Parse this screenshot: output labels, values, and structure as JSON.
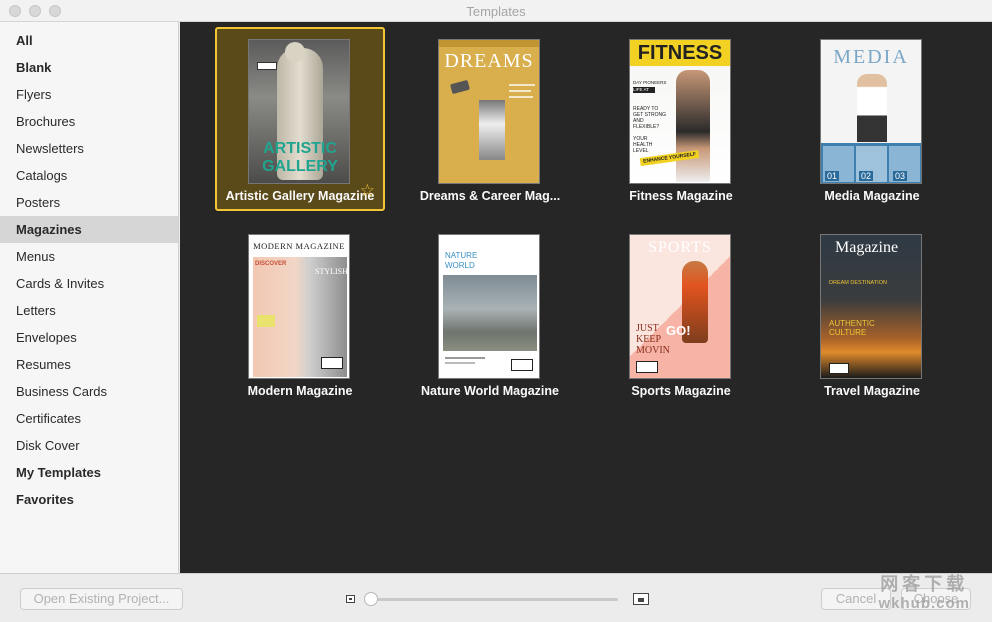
{
  "window": {
    "title": "Templates"
  },
  "sidebar": {
    "items": [
      {
        "label": "All",
        "bold": true
      },
      {
        "label": "Blank",
        "bold": true
      },
      {
        "label": "Flyers"
      },
      {
        "label": "Brochures"
      },
      {
        "label": "Newsletters"
      },
      {
        "label": "Catalogs"
      },
      {
        "label": "Posters"
      },
      {
        "label": "Magazines",
        "selected": true
      },
      {
        "label": "Menus"
      },
      {
        "label": "Cards & Invites"
      },
      {
        "label": "Letters"
      },
      {
        "label": "Envelopes"
      },
      {
        "label": "Resumes"
      },
      {
        "label": "Business Cards"
      },
      {
        "label": "Certificates"
      },
      {
        "label": "Disk Cover"
      },
      {
        "label": "My Templates",
        "bold": true
      },
      {
        "label": "Favorites",
        "bold": true
      }
    ]
  },
  "templates": [
    {
      "name": "Artistic Gallery Magazine",
      "selected": true,
      "favorite": true,
      "cover": {
        "title_line1": "ARTISTIC",
        "title_line2": "GALLERY"
      }
    },
    {
      "name": "Dreams & Career Mag...",
      "cover": {
        "title": "DREAMS"
      }
    },
    {
      "name": "Fitness Magazine",
      "cover": {
        "title": "FITNESS",
        "lines": [
          "DAY PIONEERS",
          "LIFE AT",
          "READY TO",
          "GET STRONG",
          "AND",
          "FLEXIBLE?",
          "YOUR",
          "HEALTH",
          "LEVEL"
        ],
        "badge": "ENHANCE YOURSELF"
      }
    },
    {
      "name": "Media Magazine",
      "cover": {
        "title": "MEDIA",
        "nums": [
          "01",
          "02",
          "03"
        ]
      }
    },
    {
      "name": "Modern Magazine",
      "cover": {
        "title": "MODERN MAGAZINE",
        "side": "STYLISH",
        "left": "DISCOVER"
      }
    },
    {
      "name": "Nature World Magazine",
      "cover": {
        "title_line1": "NATURE",
        "title_line2": "WORLD"
      }
    },
    {
      "name": "Sports Magazine",
      "cover": {
        "title": "SPORTS",
        "lines": [
          "JUST",
          "KEEP",
          "MOVIN"
        ],
        "go": "GO!"
      }
    },
    {
      "name": "Travel Magazine",
      "cover": {
        "title": "Magazine",
        "line1": "DREAM DESTINATION",
        "line2": "AUTHENTIC",
        "line3": "CULTURE"
      }
    }
  ],
  "footer": {
    "open_button": "Open Existing Project...",
    "cancel_button": "Cancel",
    "choose_button": "Choose",
    "zoom_level": 0.0
  },
  "watermark": {
    "line1": "网客下载",
    "line2": "wkhub.com"
  },
  "colors": {
    "selection": "#f2c534",
    "gallery_bg": "#262626",
    "sidebar_selected": "#d6d6d6"
  }
}
